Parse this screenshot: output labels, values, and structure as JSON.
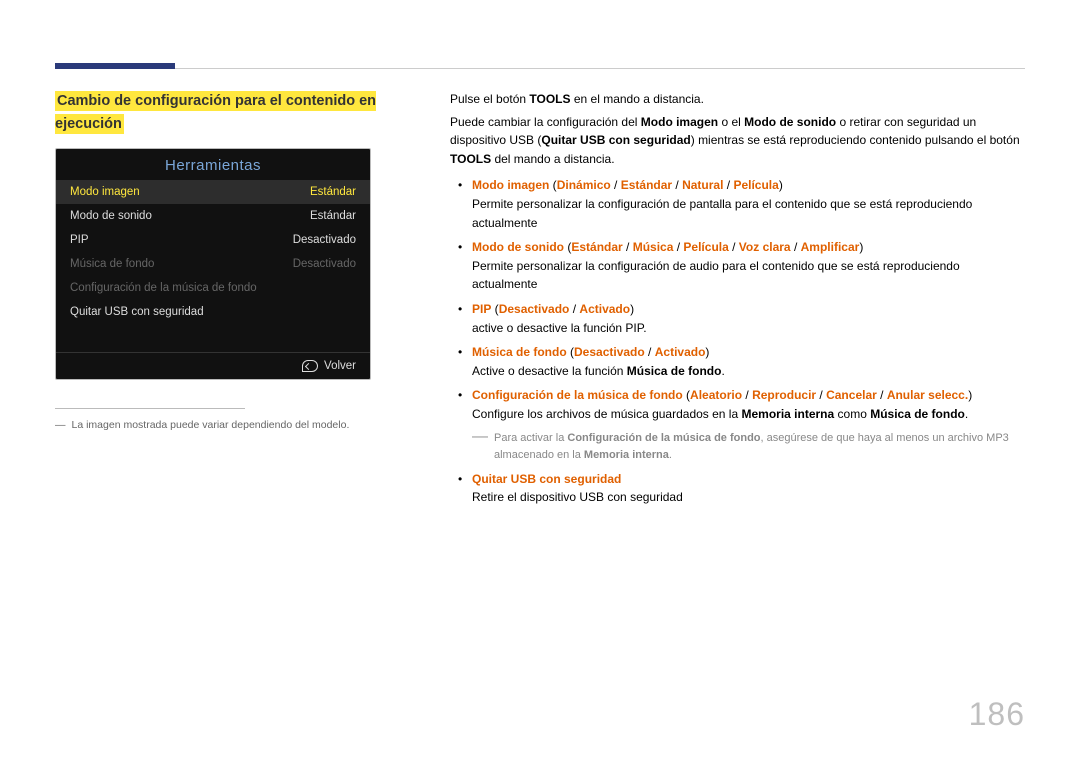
{
  "heading": "Cambio de configuración para el contenido en ejecución",
  "menu": {
    "title": "Herramientas",
    "rows": [
      {
        "label": "Modo imagen",
        "value": "Estándar",
        "sel": true
      },
      {
        "label": "Modo de sonido",
        "value": "Estándar"
      },
      {
        "label": "PIP",
        "value": "Desactivado"
      },
      {
        "label": "Música de fondo",
        "value": "Desactivado",
        "dim": true
      },
      {
        "label": "Configuración de la música de fondo",
        "value": "",
        "dim": true
      },
      {
        "label": "Quitar USB con seguridad",
        "value": ""
      }
    ],
    "return": "Volver"
  },
  "footnote": "La imagen mostrada puede variar dependiendo del modelo.",
  "intro": {
    "line1a": "Pulse el botón ",
    "line1b": "TOOLS",
    "line1c": " en el mando a distancia.",
    "line2a": "Puede cambiar la configuración del ",
    "line2b": "Modo imagen",
    "line2c": " o el ",
    "line2d": "Modo de sonido",
    "line2e": " o retirar con seguridad un dispositivo USB (",
    "line2f": "Quitar USB con seguridad",
    "line2g": ") mientras se está reproduciendo contenido pulsando el botón ",
    "line2h": "TOOLS",
    "line2i": " del mando a distancia."
  },
  "items": {
    "i1": {
      "name": "Modo imagen",
      "opts": [
        "Dinámico",
        "Estándar",
        "Natural",
        "Película"
      ],
      "desc": "Permite personalizar la configuración de pantalla para el contenido que se está reproduciendo actualmente"
    },
    "i2": {
      "name": "Modo de sonido",
      "opts": [
        "Estándar",
        "Música",
        "Película",
        "Voz clara",
        "Amplificar"
      ],
      "desc": "Permite personalizar la configuración de audio para el contenido que se está reproduciendo actualmente"
    },
    "i3": {
      "name": "PIP",
      "opts": [
        "Desactivado",
        "Activado"
      ],
      "desc": "active o desactive la función PIP."
    },
    "i4": {
      "name": "Música de fondo",
      "opts": [
        "Desactivado",
        "Activado"
      ],
      "desc_a": "Active o desactive la función ",
      "desc_b": "Música de fondo",
      "desc_c": "."
    },
    "i5": {
      "name": "Configuración de la música de fondo",
      "opts": [
        "Aleatorio",
        "Reproducir",
        "Cancelar",
        "Anular selecc."
      ],
      "desc_a": "Configure los archivos de música guardados en la ",
      "desc_b": "Memoria interna",
      "desc_c": " como ",
      "desc_d": "Música de fondo",
      "desc_e": ".",
      "note_a": "Para activar la ",
      "note_b": "Configuración de la música de fondo",
      "note_c": ", asegúrese de que haya al menos un archivo MP3 almacenado en la ",
      "note_d": "Memoria interna",
      "note_e": "."
    },
    "i6": {
      "name": "Quitar USB con seguridad",
      "desc": "Retire el dispositivo USB con seguridad"
    }
  },
  "sep": " / ",
  "lp": " (",
  "rp": ")",
  "pagenum": "186"
}
